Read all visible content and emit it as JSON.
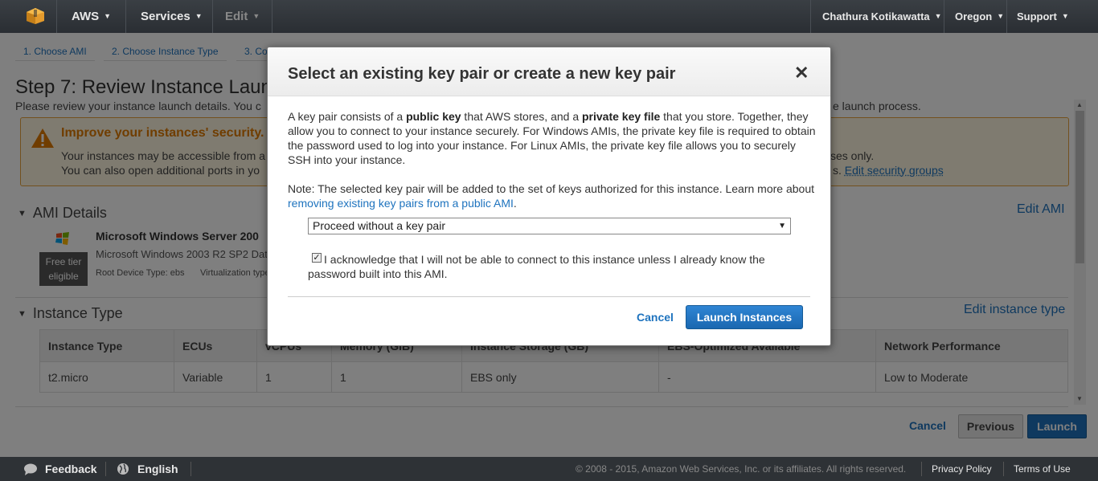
{
  "topnav": {
    "aws_label": "AWS",
    "services_label": "Services",
    "edit_label": "Edit",
    "user_label": "Chathura Kotikawatta",
    "region_label": "Oregon",
    "support_label": "Support"
  },
  "steps": [
    "1. Choose AMI",
    "2. Choose Instance Type",
    "3. Co"
  ],
  "page": {
    "title": "Step 7: Review Instance Laun",
    "desc": "Please review your instance launch details. You c",
    "desc_tail": "e launch process."
  },
  "warning": {
    "title": "Improve your instances' security.",
    "line1": "Your instances may be accessible from a",
    "line2": "You can also open additional ports in yo",
    "tail1": "sses only.",
    "tail2_prefix": "s.",
    "link": "Edit security groups"
  },
  "ami": {
    "section_title": "AMI Details",
    "edit_link": "Edit AMI",
    "name": "Microsoft Windows Server 200",
    "desc": "Microsoft Windows 2003 R2 SP2 Dat",
    "free_tier_line1": "Free tier",
    "free_tier_line2": "eligible",
    "root_device": "Root Device Type: ebs",
    "virtualization": "Virtualization type"
  },
  "instance_type": {
    "section_title": "Instance Type",
    "edit_link": "Edit instance type",
    "columns": [
      "Instance Type",
      "ECUs",
      "vCPUs",
      "Memory (GiB)",
      "Instance Storage (GB)",
      "EBS-Optimized Available",
      "Network Performance"
    ],
    "rows": [
      [
        "t2.micro",
        "Variable",
        "1",
        "1",
        "EBS only",
        "-",
        "Low to Moderate"
      ]
    ]
  },
  "bottom_buttons": {
    "cancel": "Cancel",
    "previous": "Previous",
    "launch": "Launch"
  },
  "footer": {
    "feedback": "Feedback",
    "language": "English",
    "copyright": "© 2008 - 2015, Amazon Web Services, Inc. or its affiliates. All rights reserved.",
    "privacy": "Privacy Policy",
    "terms": "Terms of Use"
  },
  "modal": {
    "title": "Select an existing key pair or create a new key pair",
    "close_glyph": "✕",
    "p1_a": "A key pair consists of a ",
    "p1_b": "public key",
    "p1_c": " that AWS stores, and a ",
    "p1_d": "private key file",
    "p1_e": " that you store. Together, they allow you to connect to your instance securely. For Windows AMIs, the private key file is required to obtain the password used to log into your instance. For Linux AMIs, the private key file allows you to securely SSH into your instance.",
    "note_a": "Note: The selected key pair will be added to the set of keys authorized for this instance. Learn more about ",
    "note_link": "removing existing key pairs from a public AMI",
    "note_end": ".",
    "select_value": "Proceed without a key pair",
    "ack_checked": true,
    "ack_text": "I acknowledge that I will not be able to connect to this instance unless I already know the password built into this AMI.",
    "cancel": "Cancel",
    "launch": "Launch Instances"
  }
}
